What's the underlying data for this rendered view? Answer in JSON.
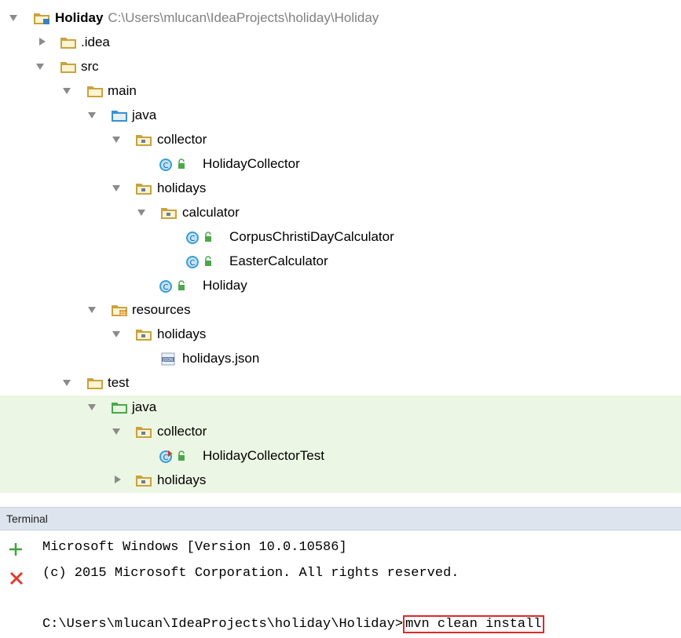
{
  "tree": {
    "root": {
      "label": "Holiday",
      "path": "C:\\Users\\mlucan\\IdeaProjects\\holiday\\Holiday"
    },
    "items": [
      {
        "label": ".idea"
      },
      {
        "label": "src"
      },
      {
        "label": "main"
      },
      {
        "label": "java"
      },
      {
        "label": "collector"
      },
      {
        "label": "HolidayCollector"
      },
      {
        "label": "holidays"
      },
      {
        "label": "calculator"
      },
      {
        "label": "CorpusChristiDayCalculator"
      },
      {
        "label": "EasterCalculator"
      },
      {
        "label": "Holiday"
      },
      {
        "label": "resources"
      },
      {
        "label": "holidays"
      },
      {
        "label": "holidays.json"
      },
      {
        "label": "test"
      },
      {
        "label": "java"
      },
      {
        "label": "collector"
      },
      {
        "label": "HolidayCollectorTest"
      },
      {
        "label": "holidays"
      }
    ]
  },
  "terminal": {
    "title": "Terminal",
    "lines": [
      "Microsoft Windows [Version 10.0.10586]",
      "(c) 2015 Microsoft Corporation. All rights reserved.",
      ""
    ],
    "prompt": "C:\\Users\\mlucan\\IdeaProjects\\holiday\\Holiday>",
    "command": "mvn clean install"
  },
  "colors": {
    "test_background": "#ecf6e4",
    "command_highlight": "#e0282c",
    "folder": "#c9a23f",
    "class_icon": "#3b9ed8",
    "lock": "#4aa84a"
  }
}
